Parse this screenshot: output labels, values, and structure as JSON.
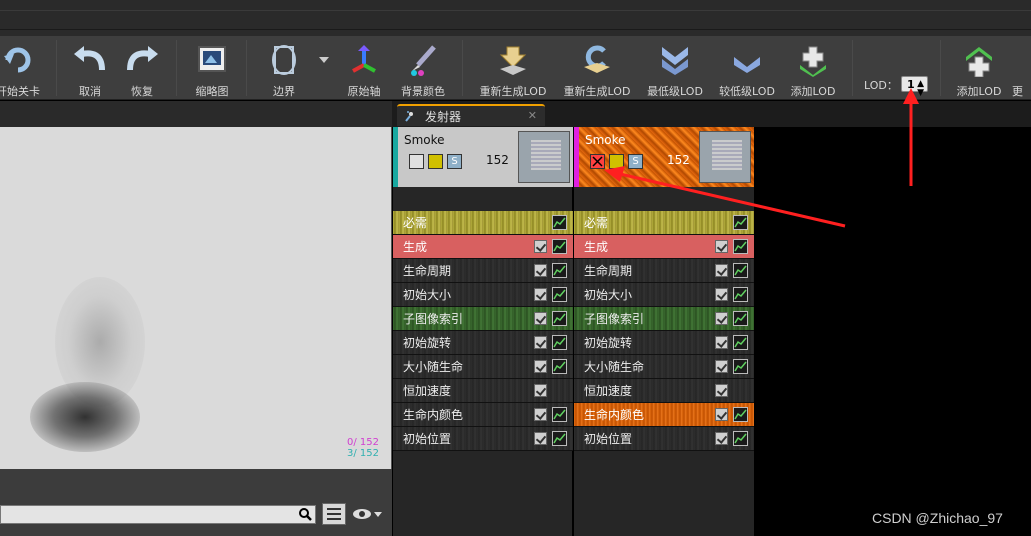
{
  "toolbar": {
    "buttons": [
      {
        "label": "开始关卡",
        "icon": "play-icon"
      },
      {
        "label": "取消",
        "icon": "undo-icon"
      },
      {
        "label": "恢复",
        "icon": "redo-icon"
      },
      {
        "label": "缩略图",
        "icon": "thumbnail-icon"
      },
      {
        "label": "边界",
        "icon": "bounds-icon"
      },
      {
        "label": "原始轴",
        "icon": "axis-icon"
      },
      {
        "label": "背景颜色",
        "icon": "background-color-icon"
      },
      {
        "label": "重新生成LOD",
        "icon": "regen-lod-icon"
      },
      {
        "label": "重新生成LOD",
        "icon": "regen-lod-duplicate-icon"
      },
      {
        "label": "最低级LOD",
        "icon": "lowest-lod-icon"
      },
      {
        "label": "较低级LOD",
        "icon": "lower-lod-icon"
      },
      {
        "label": "添加LOD",
        "icon": "add-lod-icon"
      },
      {
        "label": "添加LOD",
        "icon": "add-lod-after-icon"
      },
      {
        "label": "更",
        "icon": "more-icon"
      }
    ],
    "lod_label": "LOD：",
    "lod_value": "1"
  },
  "tab": {
    "label": "发射器",
    "close": "✕"
  },
  "viewport": {
    "stat1": "0/ 152",
    "stat2": "3/ 152"
  },
  "emitters": [
    {
      "name": "Smoke",
      "count": "152",
      "color_bar": "#18a8a0",
      "enabled": true
    },
    {
      "name": "Smoke",
      "count": "152",
      "color_bar": "#e020e0",
      "enabled": false
    }
  ],
  "modules": [
    {
      "label": "必需",
      "style": "req",
      "checkbox": false
    },
    {
      "label": "生成",
      "style": "spawn",
      "checkbox": true
    },
    {
      "label": "生命周期",
      "style": "dark",
      "checkbox": true
    },
    {
      "label": "初始大小",
      "style": "dark",
      "checkbox": true
    },
    {
      "label": "子图像索引",
      "style": "green",
      "checkbox": true
    },
    {
      "label": "初始旋转",
      "style": "dark",
      "checkbox": true
    },
    {
      "label": "大小随生命",
      "style": "dark",
      "checkbox": true
    },
    {
      "label": "恒加速度",
      "style": "dark",
      "checkbox": true
    },
    {
      "label": "生命内颜色",
      "style": "dark",
      "checkbox": true
    },
    {
      "label": "初始位置",
      "style": "dark",
      "checkbox": true
    }
  ],
  "watermark": "CSDN @Zhichao_97"
}
